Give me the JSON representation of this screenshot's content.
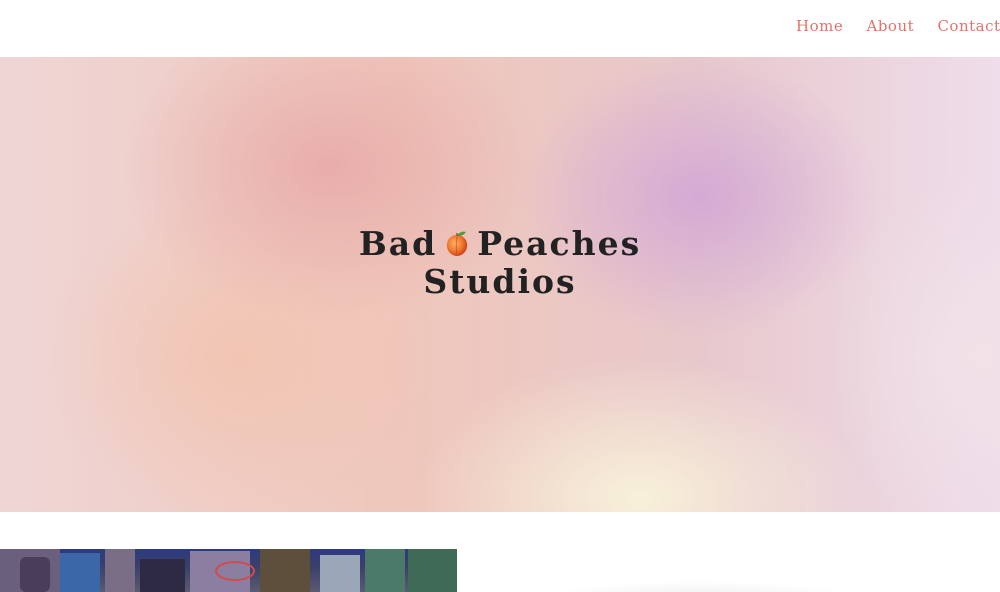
{
  "nav": {
    "items": [
      {
        "label": "Home"
      },
      {
        "label": "About"
      },
      {
        "label": "Contact"
      }
    ]
  },
  "hero": {
    "title_line1_before": "Bad",
    "title_icon": "peach-icon",
    "title_line1_after": "Peaches",
    "title_line2": "Studios"
  },
  "colors": {
    "nav_link": "#e2736a",
    "title_text": "#222222",
    "background": "#ffffff"
  }
}
